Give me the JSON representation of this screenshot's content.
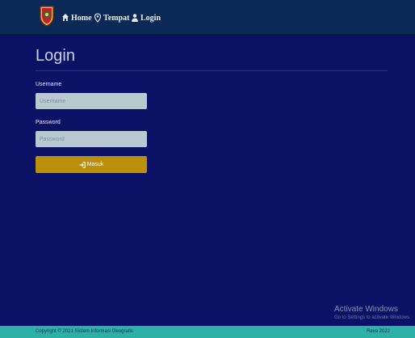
{
  "navbar": {
    "items": [
      {
        "label": "Home",
        "icon": "home-icon"
      },
      {
        "label": "Tempat",
        "icon": "map-pin-icon"
      },
      {
        "label": "Login",
        "icon": "user-icon"
      }
    ]
  },
  "page": {
    "title": "Login"
  },
  "form": {
    "username_label": "Username",
    "username_placeholder": "Username",
    "username_value": "",
    "password_label": "Password",
    "password_placeholder": "Password",
    "password_value": "",
    "submit_label": "Masuk",
    "submit_icon": "sign-in-icon"
  },
  "watermark": {
    "title": "Activate Windows",
    "subtitle": "Go to Settings to activate Windows."
  },
  "footer": {
    "copyright": "Copyright © 2021 Sistem Informasi Geografis",
    "author": "Reva 2022"
  },
  "colors": {
    "background": "#0b1266",
    "navbar": "#0a2a55",
    "button": "#b98f0c",
    "footer": "#2db0a8",
    "input": "#b9c9cf"
  }
}
